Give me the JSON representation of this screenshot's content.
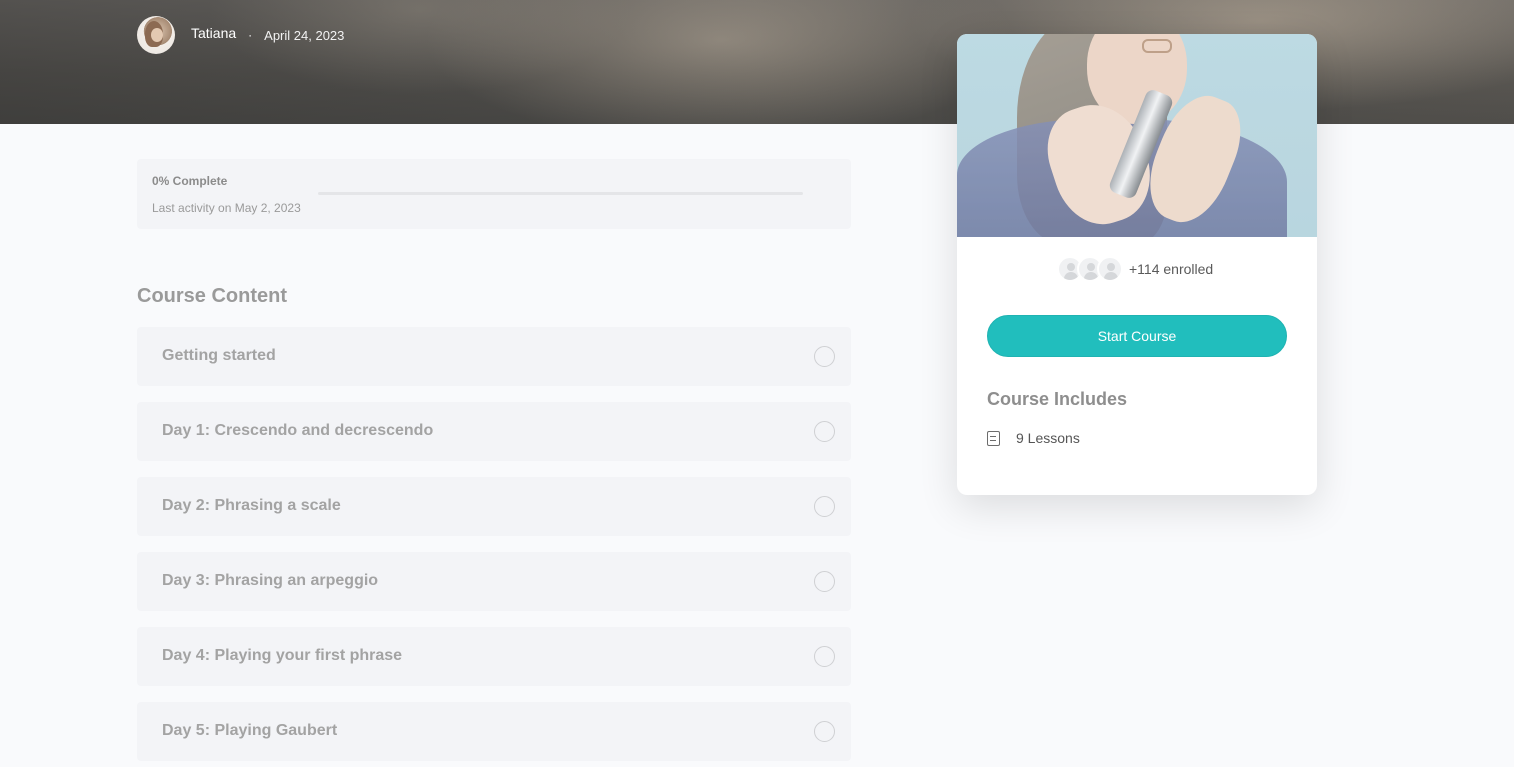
{
  "header": {
    "author_name": "Tatiana",
    "separator": "·",
    "post_date": "April 24, 2023"
  },
  "progress": {
    "complete_label": "0% Complete",
    "percent": 0,
    "last_activity": "Last activity on May 2, 2023"
  },
  "course_content": {
    "title": "Course Content",
    "lessons": [
      {
        "title": "Getting started"
      },
      {
        "title": "Day 1: Crescendo and decrescendo"
      },
      {
        "title": "Day 2: Phrasing a scale"
      },
      {
        "title": "Day 3: Phrasing an arpeggio"
      },
      {
        "title": "Day 4: Playing your first phrase"
      },
      {
        "title": "Day 5: Playing Gaubert"
      }
    ]
  },
  "sidebar": {
    "enrolled_text": "+114 enrolled",
    "start_button_label": "Start Course",
    "includes_title": "Course Includes",
    "includes_items": [
      {
        "icon": "document-icon",
        "label": "9 Lessons"
      }
    ]
  },
  "colors": {
    "accent": "#21bebd"
  }
}
